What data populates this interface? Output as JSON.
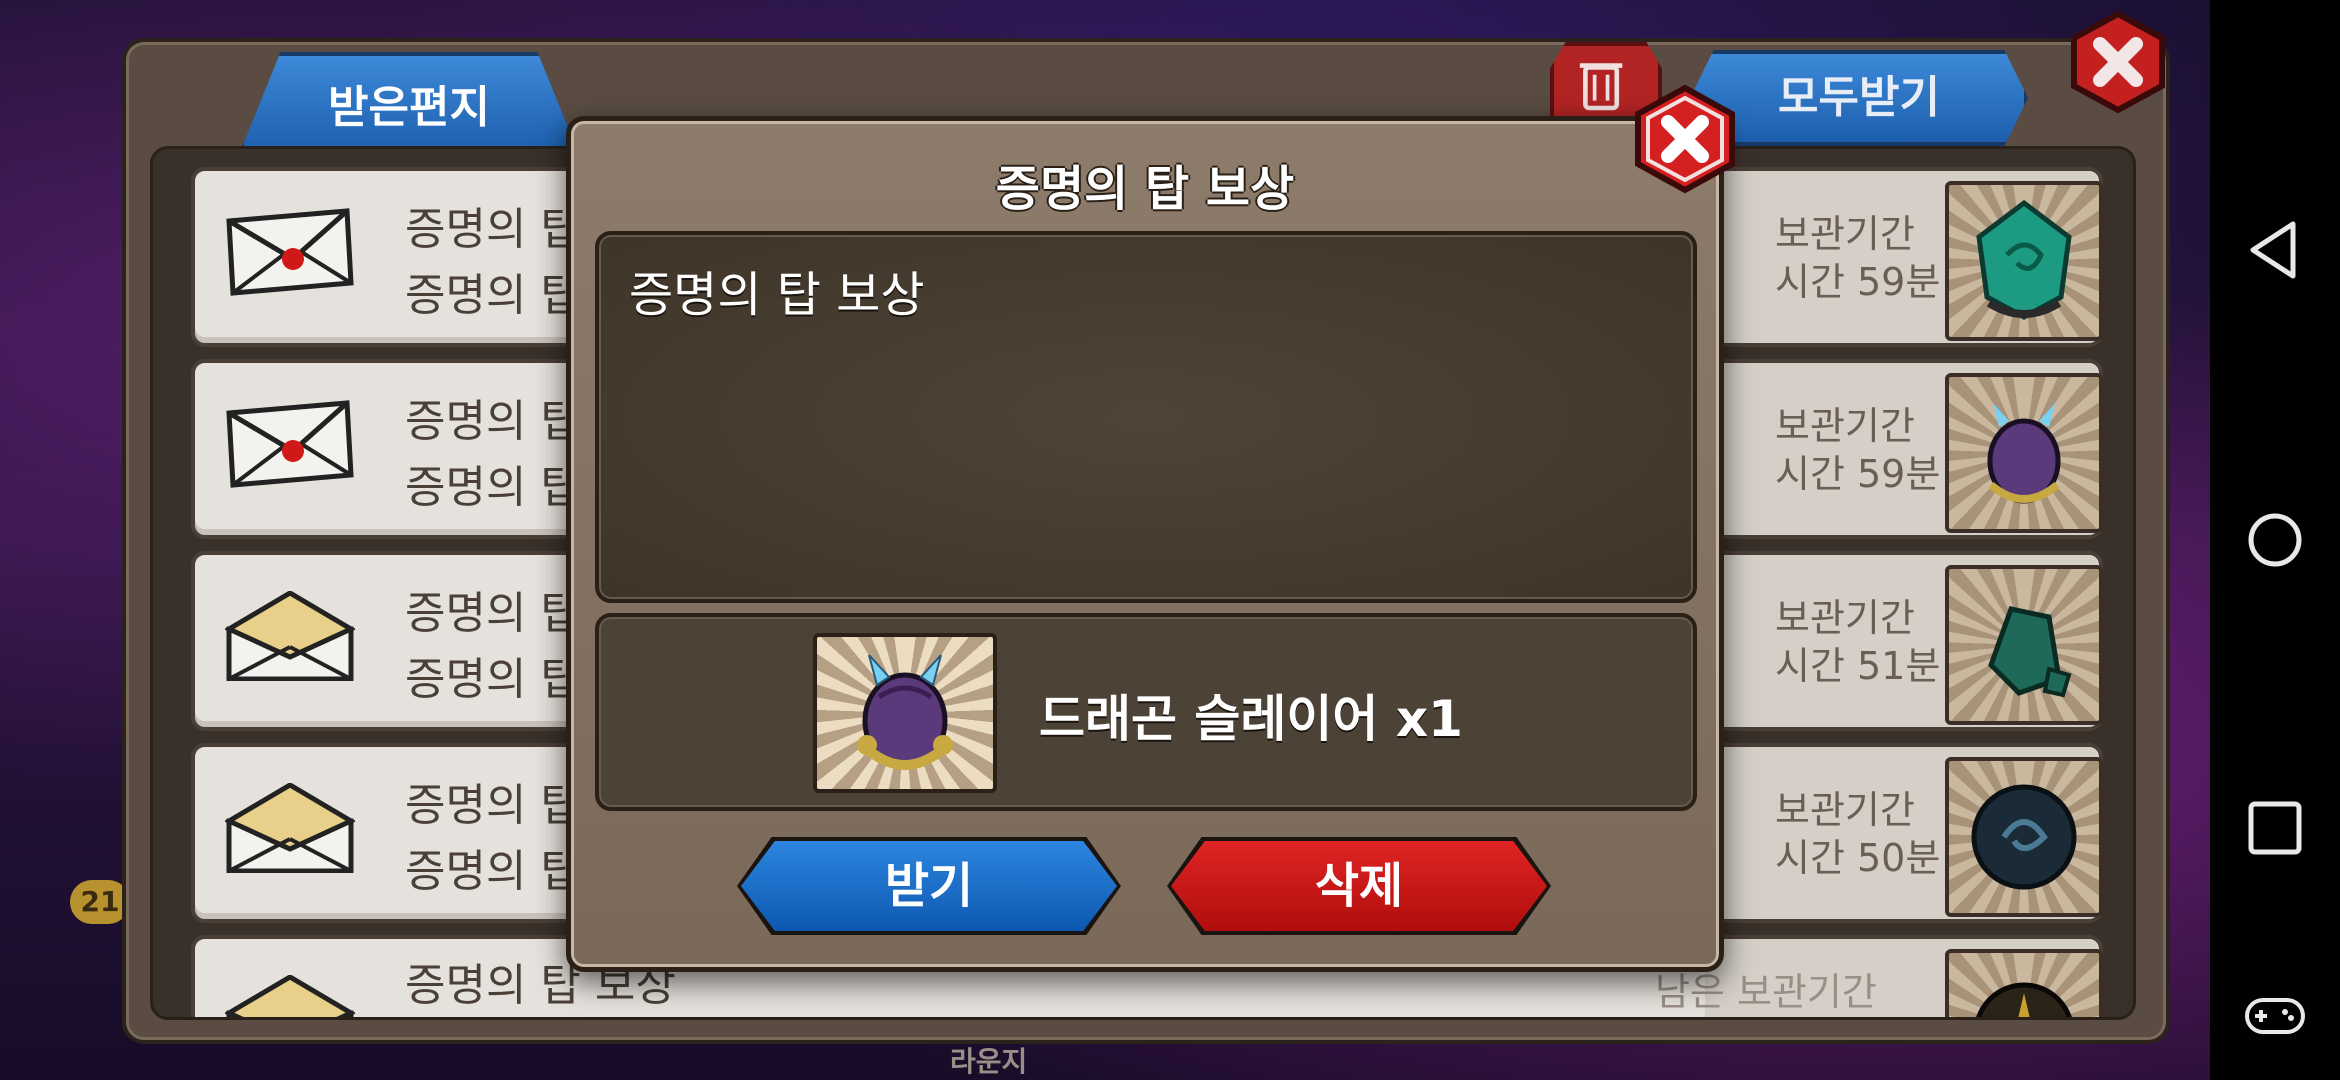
{
  "mailbox": {
    "tab_label": "받은편지",
    "receive_all_label": "모두받기",
    "rows": [
      {
        "title": "증명의 탑",
        "sub": "증명의 탑",
        "keep_label": "보관기간",
        "keep_time": "시간 59분",
        "envelope": "sealed"
      },
      {
        "title": "증명의 탑",
        "sub": "증명의 탑",
        "keep_label": "보관기간",
        "keep_time": "시간 59분",
        "envelope": "sealed"
      },
      {
        "title": "증명의 탑",
        "sub": "증명의 탑",
        "keep_label": "보관기간",
        "keep_time": "시간 51분",
        "envelope": "opened"
      },
      {
        "title": "증명의 탑",
        "sub": "증명의 탑",
        "keep_label": "보관기간",
        "keep_time": "시간 50분",
        "envelope": "opened"
      },
      {
        "title": "증명의 탑 보상",
        "sub": "",
        "keep_label": "남은 보관기간",
        "keep_time": "",
        "envelope": "opened"
      }
    ]
  },
  "modal": {
    "title": "증명의 탑 보상",
    "message": "증명의 탑 보상",
    "reward_text": "드래곤 슬레이어 x1",
    "receive_label": "받기",
    "delete_label": "삭제"
  },
  "background": {
    "level_badge": "21",
    "caption": "라운지"
  },
  "colors": {
    "accent_blue": "#1d5fae",
    "danger_red": "#b00d0d",
    "panel_brown": "#7a6858"
  },
  "icons": {
    "close": "close-icon",
    "trash": "trash-icon",
    "back": "back-triangle-icon",
    "home": "home-circle-icon",
    "recents": "recents-square-icon",
    "gamepad": "gamepad-icon"
  }
}
